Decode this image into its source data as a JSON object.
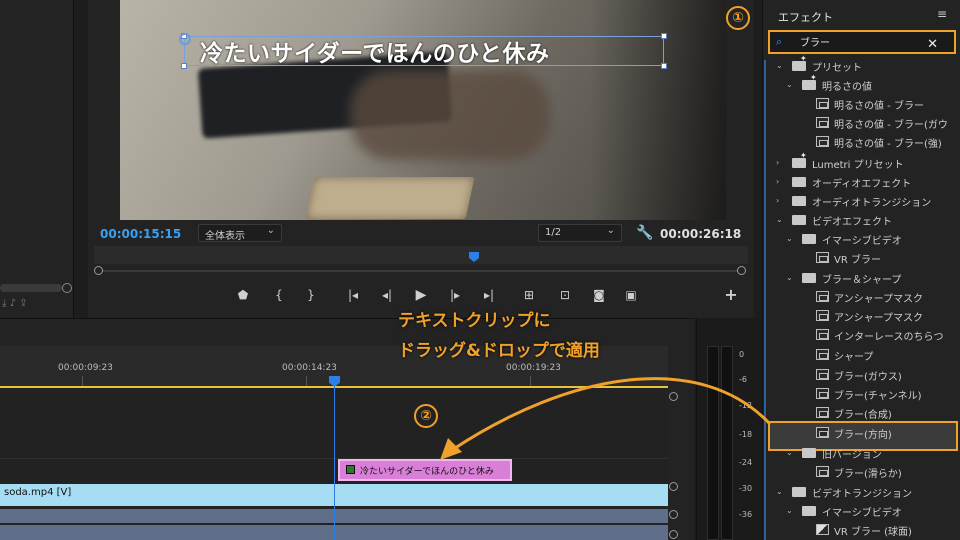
{
  "program_monitor": {
    "title_overlay": "冷たいサイダーでほんのひと休み",
    "current_timecode": "00:00:15:15",
    "zoom_option": "全体表示",
    "resolution_option": "1/2",
    "duration_timecode": "00:00:26:18"
  },
  "transport": {
    "buttons": [
      "marker-icon",
      "mark-in-icon",
      "mark-out-icon",
      "go-to-in-icon",
      "step-back-icon",
      "play-icon",
      "step-forward-icon",
      "go-to-out-icon",
      "insert-icon",
      "overwrite-icon",
      "export-frame-icon",
      "comparison-view-icon",
      "add-button-icon"
    ]
  },
  "timeline": {
    "ruler_timecodes": [
      "00:00:09:23",
      "00:00:14:23",
      "00:00:19:23"
    ],
    "title_clip_label": "冷たいサイダーでほんのひと休み",
    "video_clip_label": "soda.mp4 [V]"
  },
  "audio_meter": {
    "labels": [
      "0",
      "-6",
      "-12",
      "-18",
      "-24",
      "-30",
      "-36"
    ]
  },
  "effects_panel": {
    "title": "エフェクト",
    "search_value": "ブラー",
    "items": [
      {
        "label": "プリセット"
      },
      {
        "label": "明るさの値"
      },
      {
        "label": "明るさの値 - ブラー"
      },
      {
        "label": "明るさの値 - ブラー(ガウ"
      },
      {
        "label": "明るさの値 - ブラー(強)"
      },
      {
        "label": "Lumetri プリセット"
      },
      {
        "label": "オーディオエフェクト"
      },
      {
        "label": "オーディオトランジション"
      },
      {
        "label": "ビデオエフェクト"
      },
      {
        "label": "イマーシブビデオ"
      },
      {
        "label": "VR ブラー"
      },
      {
        "label": "ブラー＆シャープ"
      },
      {
        "label": "アンシャープマスク"
      },
      {
        "label": "アンシャープマスク"
      },
      {
        "label": "インターレースのちらつ"
      },
      {
        "label": "シャープ"
      },
      {
        "label": "ブラー(ガウス)"
      },
      {
        "label": "ブラー(チャンネル)"
      },
      {
        "label": "ブラー(合成)"
      },
      {
        "label": "ブラー(方向)"
      },
      {
        "label": "旧バージョン"
      },
      {
        "label": "ブラー(滑らか)"
      },
      {
        "label": "ビデオトランジション"
      },
      {
        "label": "イマーシブビデオ"
      },
      {
        "label": "VR ブラー (球面)"
      }
    ]
  },
  "annotations": {
    "badge1": "①",
    "badge2": "②",
    "line1": "テキストクリップに",
    "line2": "ドラッグ&ドロップで適用",
    "accent_color": "#f0a12a"
  }
}
